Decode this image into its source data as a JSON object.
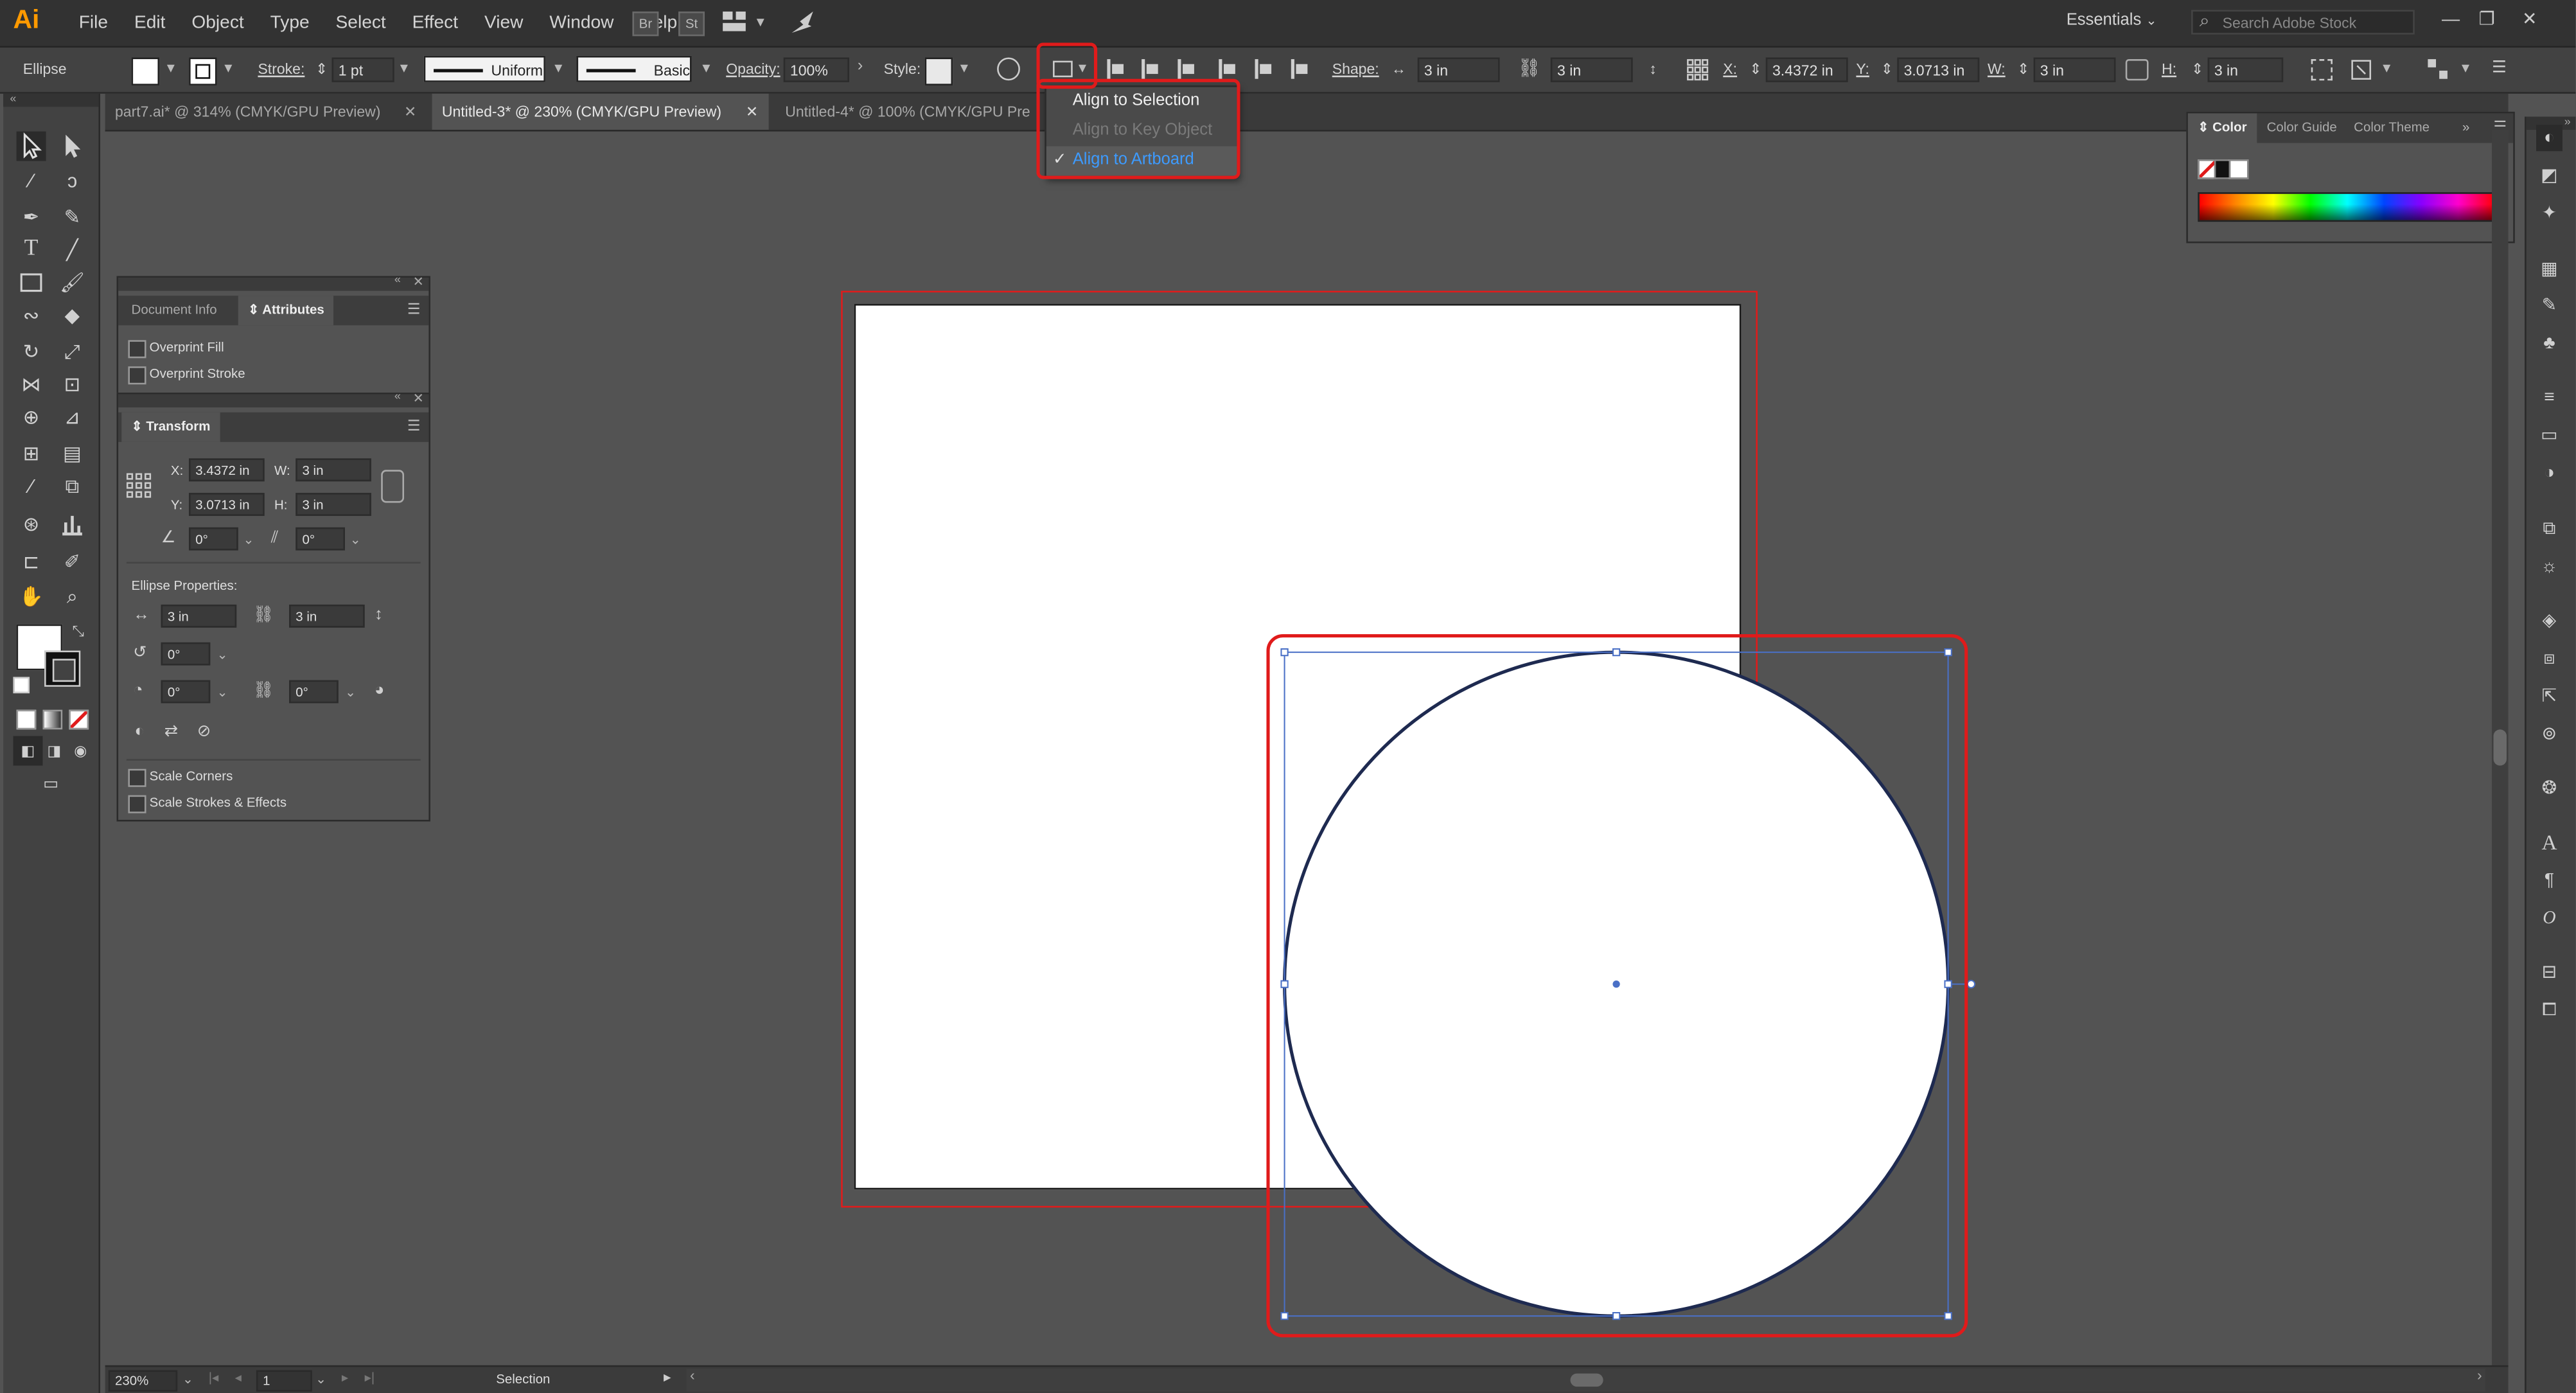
{
  "app": {
    "logo": "Ai"
  },
  "menu": [
    "File",
    "Edit",
    "Object",
    "Type",
    "Select",
    "Effect",
    "View",
    "Window",
    "Help"
  ],
  "menubar_icons": {
    "bridge": "Br",
    "stock": "St"
  },
  "workspace": "Essentials",
  "search": {
    "placeholder": "Search Adobe Stock"
  },
  "control": {
    "object_type": "Ellipse",
    "stroke_label": "Stroke:",
    "stroke_weight": "1 pt",
    "variable_width": "Uniform",
    "brush": "Basic",
    "opacity_label": "Opacity:",
    "opacity": "100%",
    "style_label": "Style:",
    "shape_label": "Shape:",
    "shape_w": "3 in",
    "shape_h": "3 in",
    "x_label": "X:",
    "x": "3.4372 in",
    "y_label": "Y:",
    "y": "3.0713 in",
    "w_label": "W:",
    "w": "3 in",
    "h_label": "H:",
    "h": "3 in"
  },
  "align_menu": {
    "items": [
      {
        "label": "Align to Selection",
        "state": "normal"
      },
      {
        "label": "Align to Key Object",
        "state": "disabled"
      },
      {
        "label": "Align to Artboard",
        "state": "checked"
      }
    ],
    "accent": "#3d9bff"
  },
  "tabs": [
    {
      "label": "part7.ai* @ 314% (CMYK/GPU Preview)",
      "active": false
    },
    {
      "label": "Untitled-3* @ 230% (CMYK/GPU Preview)",
      "active": true
    },
    {
      "label": "Untitled-4* @ 100% (CMYK/GPU Pre",
      "active": false
    }
  ],
  "attributes_panel": {
    "tabs": [
      "Document Info",
      "Attributes"
    ],
    "overprint_fill": "Overprint Fill",
    "overprint_stroke": "Overprint Stroke"
  },
  "transform_panel": {
    "title": "Transform",
    "x_label": "X:",
    "x": "3.4372 in",
    "y_label": "Y:",
    "y": "3.0713 in",
    "w_label": "W:",
    "w": "3 in",
    "h_label": "H:",
    "h": "3 in",
    "angle": "0°",
    "shear": "0°",
    "ellipse_title": "Ellipse Properties:",
    "ellipse_w": "3 in",
    "ellipse_h": "3 in",
    "rotation": "0°",
    "pie_start": "0°",
    "pie_end": "0°",
    "scale_corners": "Scale Corners",
    "scale_strokes": "Scale Strokes & Effects"
  },
  "color_panel": {
    "tabs": [
      "Color",
      "Color Guide",
      "Color Theme"
    ]
  },
  "status": {
    "zoom": "230%",
    "artboard": "1",
    "tool": "Selection"
  },
  "colors": {
    "highlight": "#e01b1b",
    "selection": "#4a70c6",
    "ellipse_stroke": "#1e2a50"
  }
}
